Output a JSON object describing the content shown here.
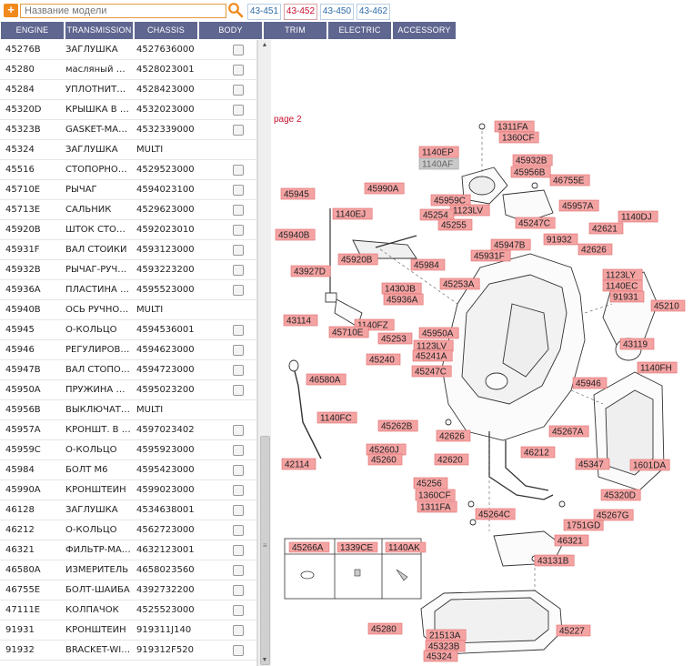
{
  "toolbar": {
    "add_label": "+",
    "search_placeholder": "Название модели",
    "tabs": [
      {
        "label": "43-451",
        "active": false
      },
      {
        "label": "43-452",
        "active": true
      },
      {
        "label": "43-450",
        "active": false
      },
      {
        "label": "43-462",
        "active": false
      }
    ]
  },
  "categories": [
    "ENGINE",
    "TRANSMISSION",
    "CHASSIS",
    "BODY",
    "TRIM",
    "ELECTRIC",
    "ACCESSORY"
  ],
  "parts": [
    {
      "code": "45276B",
      "name": "ЗАГЛУШКА",
      "number": "4527636000",
      "checkbox": true
    },
    {
      "code": "45280",
      "name": "масляный поддон",
      "number": "4528023001",
      "checkbox": true
    },
    {
      "code": "45284",
      "name": "УПЛОТНИТЕЛЬ",
      "number": "4528423000",
      "checkbox": true
    },
    {
      "code": "45320D",
      "name": "КРЫШКА В СБОРЕ",
      "number": "4532023000",
      "checkbox": true
    },
    {
      "code": "45323B",
      "name": "GASKET-MANUAL",
      "number": "4532339000",
      "checkbox": true
    },
    {
      "code": "45324",
      "name": "ЗАГЛУШКА",
      "number": "MULTI",
      "checkbox": false
    },
    {
      "code": "45516",
      "name": "СТОПОРНОЕ КОЛЬЦО",
      "number": "4529523000",
      "checkbox": true
    },
    {
      "code": "45710E",
      "name": "РЫЧАГ",
      "number": "4594023100",
      "checkbox": true
    },
    {
      "code": "45713E",
      "name": "САЛЬНИК",
      "number": "4529623000",
      "checkbox": true
    },
    {
      "code": "45920B",
      "name": "ШТОК СТОПОРА",
      "number": "4592023010",
      "checkbox": true
    },
    {
      "code": "45931F",
      "name": "ВАЛ СТОЙКИ",
      "number": "4593123000",
      "checkbox": true
    },
    {
      "code": "45932B",
      "name": "РЫЧАГ-РУЧНОЙ",
      "number": "4593223200",
      "checkbox": true
    },
    {
      "code": "45936A",
      "name": "ПЛАСТИНА ФИКС",
      "number": "4595523000",
      "checkbox": true
    },
    {
      "code": "45940B",
      "name": "ОСЬ РУЧНОГО",
      "number": "MULTI",
      "checkbox": false
    },
    {
      "code": "45945",
      "name": "О-КОЛЬЦО",
      "number": "4594536001",
      "checkbox": true
    },
    {
      "code": "45946",
      "name": "РЕГУЛИРОВОЧНАЯ",
      "number": "4594623000",
      "checkbox": true
    },
    {
      "code": "45947B",
      "name": "ВАЛ СТОПОРА",
      "number": "4594723000",
      "checkbox": true
    },
    {
      "code": "45950A",
      "name": "ПРУЖИНА СТОП",
      "number": "4595023200",
      "checkbox": true
    },
    {
      "code": "45956B",
      "name": "ВЫКЛЮЧАТЕЛЬ",
      "number": "MULTI",
      "checkbox": false
    },
    {
      "code": "45957A",
      "name": "КРОНШТ. В СБ",
      "number": "4597023402",
      "checkbox": true
    },
    {
      "code": "45959C",
      "name": "О-КОЛЬЦО",
      "number": "4595923000",
      "checkbox": true
    },
    {
      "code": "45984",
      "name": "БОЛТ М6",
      "number": "4595423000",
      "checkbox": true
    },
    {
      "code": "45990A",
      "name": "КРОНШТЕЙН",
      "number": "4599023000",
      "checkbox": true
    },
    {
      "code": "46128",
      "name": "ЗАГЛУШКА",
      "number": "4534638001",
      "checkbox": true
    },
    {
      "code": "46212",
      "name": "О-КОЛЬЦО",
      "number": "4562723000",
      "checkbox": true
    },
    {
      "code": "46321",
      "name": "ФИЛЬТР-МАСЛ",
      "number": "4632123001",
      "checkbox": true
    },
    {
      "code": "46580A",
      "name": "ИЗМЕРИТЕЛЬ",
      "number": "4658023560",
      "checkbox": true
    },
    {
      "code": "46755E",
      "name": "БОЛТ-ШАЙБА",
      "number": "4392732200",
      "checkbox": true
    },
    {
      "code": "47111E",
      "name": "КОЛПАЧОК",
      "number": "4525523000",
      "checkbox": true
    },
    {
      "code": "91931",
      "name": "КРОНШТЕЙН",
      "number": "919311J140",
      "checkbox": true
    },
    {
      "code": "91932",
      "name": "BRACKET-WIRING",
      "number": "919312F520",
      "checkbox": true
    }
  ],
  "diagram": {
    "page_label": "page 2",
    "callouts": [
      "1311FA",
      "1360CF",
      "1140EP",
      "1140AF",
      "45932B",
      "45956B",
      "46755E",
      "45945",
      "45990A",
      "45959C",
      "1123LV",
      "45957A",
      "1140EJ",
      "45254",
      "45255",
      "45247C",
      "42621",
      "1140DJ",
      "45940B",
      "45920B",
      "45947B",
      "91932",
      "42626",
      "45931F",
      "45984",
      "43927D",
      "1430JB",
      "45253A",
      "1123LY",
      "1140EC",
      "91931",
      "45210",
      "45936A",
      "43114",
      "1140FZ",
      "45950A",
      "45710E",
      "45253",
      "1123LV",
      "45241A",
      "43119",
      "45240",
      "45247C",
      "46580A",
      "45946",
      "1140FH",
      "1140FC",
      "45262B",
      "42626",
      "45267A",
      "46212",
      "45260J",
      "45260",
      "42620",
      "42114",
      "45347",
      "1601DA",
      "45256",
      "1360CF",
      "1311FA",
      "45264C",
      "45320D",
      "1751GD",
      "45267G",
      "46321",
      "43131B",
      "45280",
      "21513A",
      "45323B",
      "45324",
      "45227"
    ],
    "legend": [
      "45266A",
      "1339CE",
      "1140AK"
    ]
  },
  "colors": {
    "accent": "#f08a1c",
    "header": "#5f6690",
    "callout_fill": "#f4a3a3",
    "callout_border": "#e26a6a",
    "active_tab": "#c8102e"
  }
}
